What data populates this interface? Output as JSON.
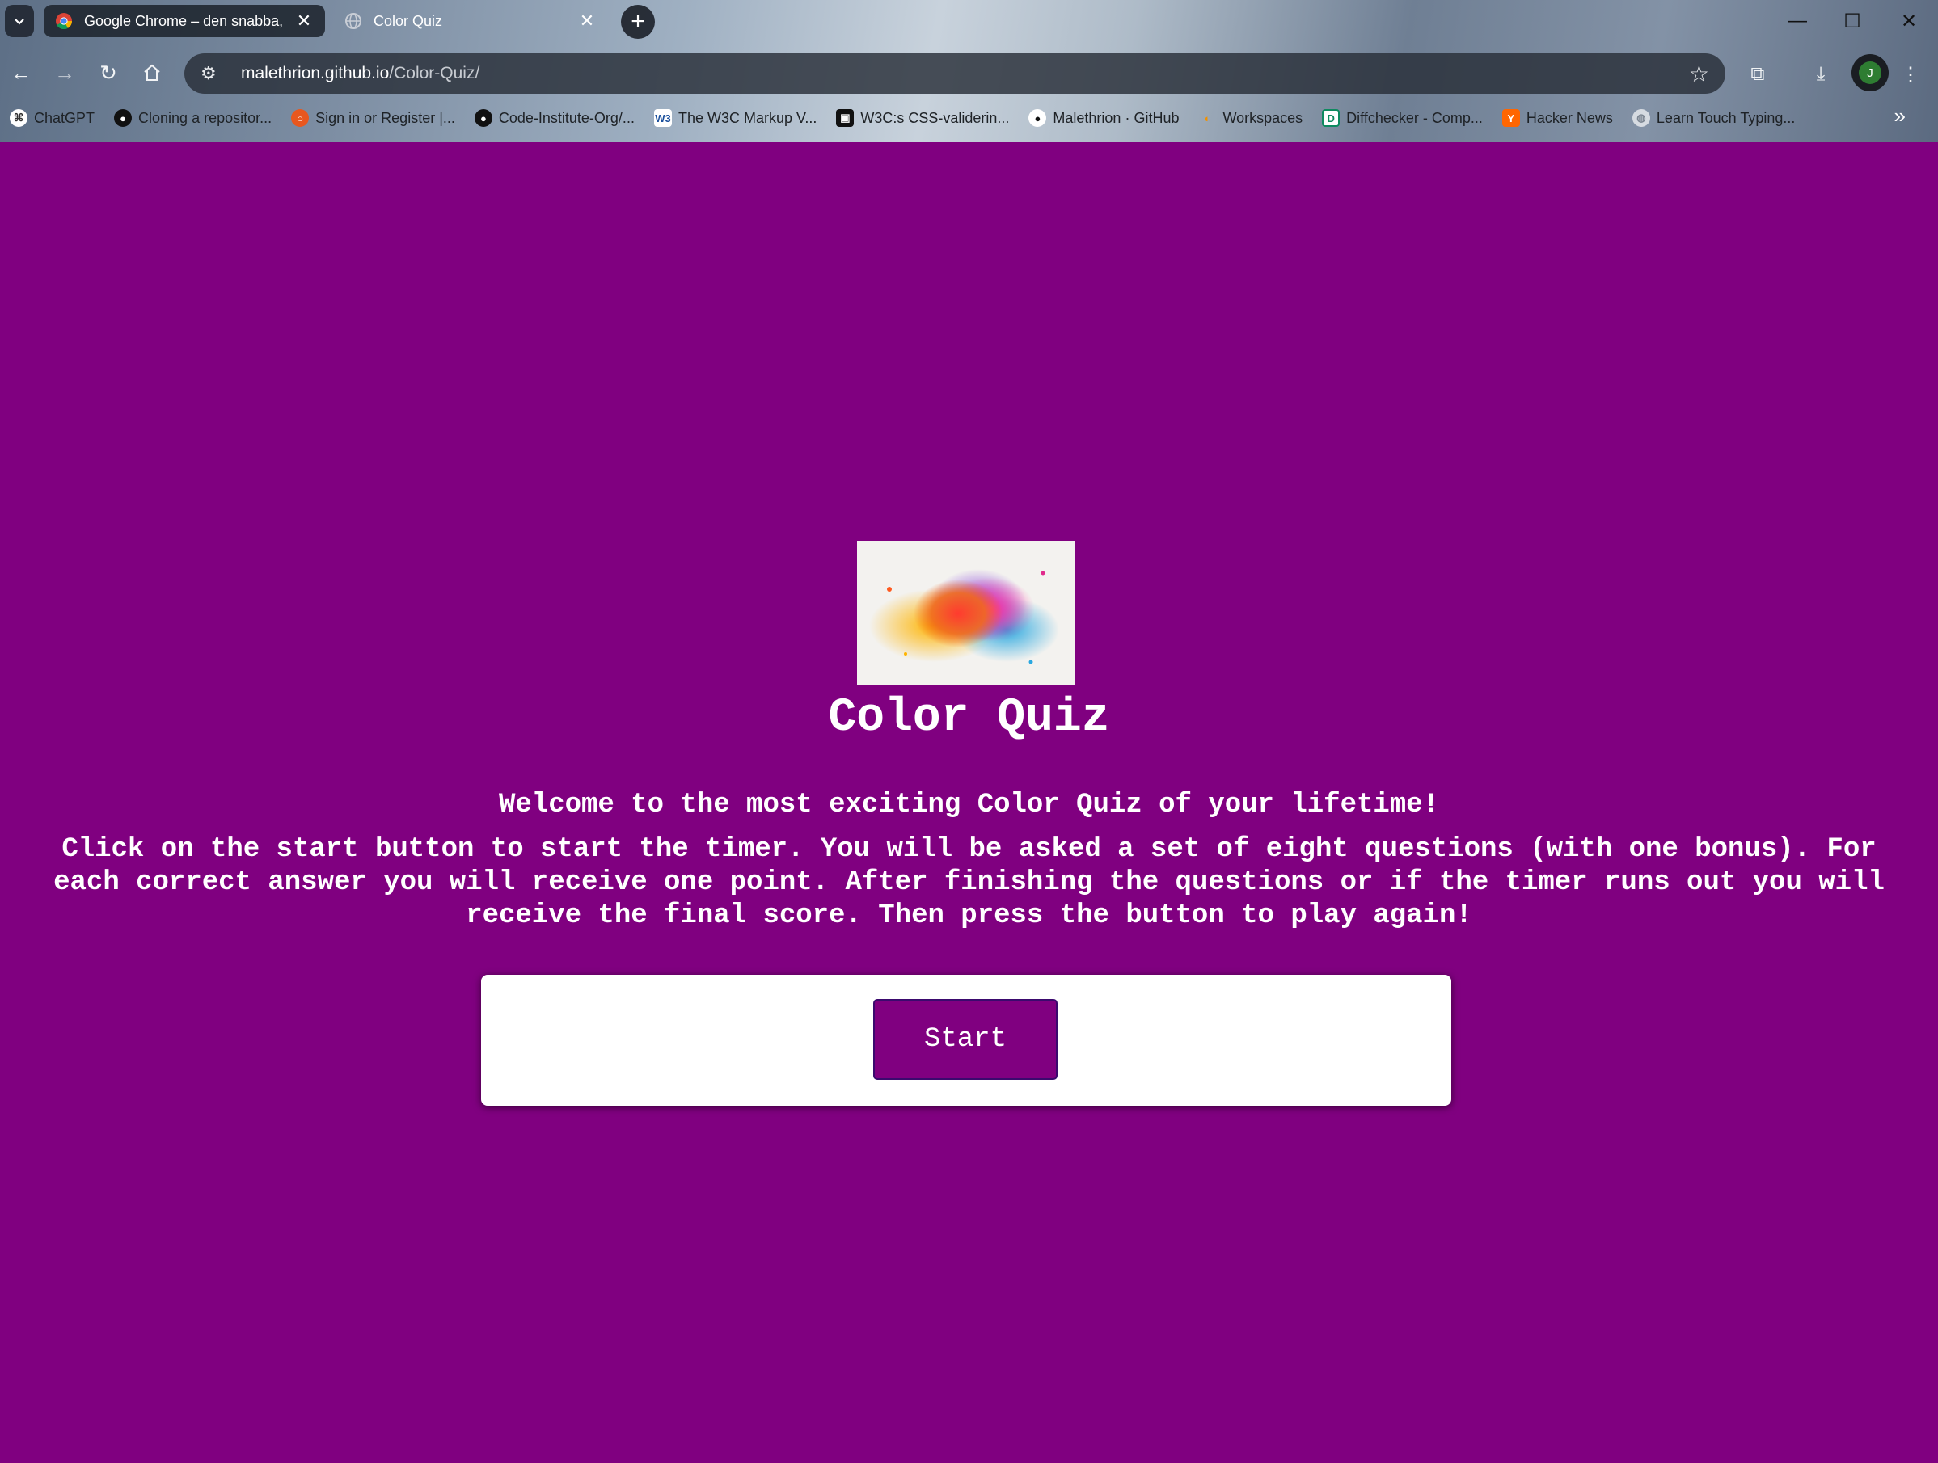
{
  "browser": {
    "tabs": [
      {
        "title": "Google Chrome – den snabba,",
        "active": true
      },
      {
        "title": "Color Quiz",
        "active": false
      }
    ],
    "url_host": "malethrion.github.io",
    "url_path": "/Color-Quiz/",
    "avatar_letter": "J",
    "bookmarks": [
      {
        "label": "ChatGPT",
        "icon": "chatgpt-icon"
      },
      {
        "label": "Cloning a repositor...",
        "icon": "github-icon"
      },
      {
        "label": "Sign in or Register |...",
        "icon": "circle-logo-icon"
      },
      {
        "label": "Code-Institute-Org/...",
        "icon": "github-icon"
      },
      {
        "label": "The W3C Markup V...",
        "icon": "w3c-icon"
      },
      {
        "label": "W3C:s CSS-validerin...",
        "icon": "css-icon"
      },
      {
        "label": "Malethrion · GitHub",
        "icon": "github-icon"
      },
      {
        "label": "Workspaces",
        "icon": "workspaces-icon"
      },
      {
        "label": "Diffchecker - Comp...",
        "icon": "diffchecker-icon"
      },
      {
        "label": "Hacker News",
        "icon": "hackernews-icon"
      },
      {
        "label": "Learn Touch Typing...",
        "icon": "globe-icon"
      }
    ]
  },
  "page": {
    "title": "Color Quiz",
    "welcome": "Welcome to the most exciting Color Quiz of your lifetime!",
    "instructions": "Click on the start button to start the timer. You will be asked a set of eight questions (with one bonus). For each correct answer you will receive one point. After finishing the questions or if the timer runs out you will receive the final score. Then press the button to play again!",
    "start_label": "Start",
    "background_color": "#800080"
  }
}
